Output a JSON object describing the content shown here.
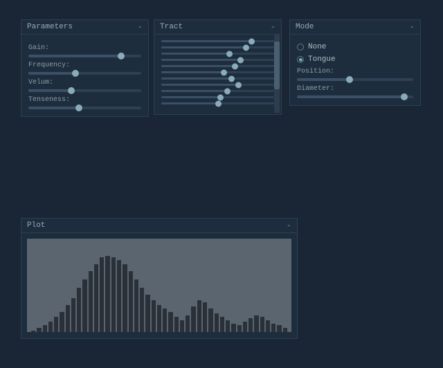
{
  "panels": {
    "parameters": {
      "title": "Parameters",
      "minimize": "-",
      "params": [
        {
          "label": "Gain:",
          "fill_pct": 82,
          "thumb_pct": 82
        },
        {
          "label": "Frequency:",
          "fill_pct": 42,
          "thumb_pct": 42
        },
        {
          "label": "Velum:",
          "fill_pct": 38,
          "thumb_pct": 38
        },
        {
          "label": "Tenseness:",
          "fill_pct": 45,
          "thumb_pct": 45
        }
      ]
    },
    "tract": {
      "title": "Tract",
      "minimize": "-",
      "sliders": [
        {
          "thumb_pct": 80
        },
        {
          "thumb_pct": 75
        },
        {
          "thumb_pct": 60
        },
        {
          "thumb_pct": 70
        },
        {
          "thumb_pct": 65
        },
        {
          "thumb_pct": 55
        },
        {
          "thumb_pct": 62
        },
        {
          "thumb_pct": 68
        },
        {
          "thumb_pct": 58
        },
        {
          "thumb_pct": 52
        },
        {
          "thumb_pct": 50
        }
      ]
    },
    "mode": {
      "title": "Mode",
      "minimize": "-",
      "options": [
        {
          "label": "None",
          "selected": false
        },
        {
          "label": "Tongue",
          "selected": true
        }
      ],
      "position_label": "Position:",
      "position_thumb_pct": 45,
      "diameter_label": "Diameter:",
      "diameter_thumb_pct": 92
    },
    "plot": {
      "title": "Plot",
      "minimize": "-",
      "bars": [
        2,
        5,
        8,
        12,
        18,
        24,
        32,
        40,
        52,
        62,
        72,
        80,
        88,
        90,
        88,
        85,
        80,
        72,
        62,
        52,
        44,
        38,
        32,
        28,
        24,
        18,
        14,
        20,
        30,
        38,
        35,
        28,
        22,
        18,
        14,
        10,
        8,
        12,
        16,
        20,
        18,
        14,
        10,
        8,
        5
      ]
    }
  }
}
